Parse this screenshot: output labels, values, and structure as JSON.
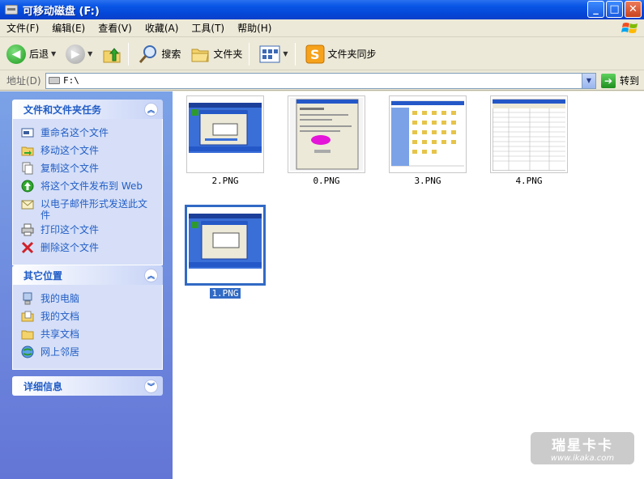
{
  "window": {
    "title": "可移动磁盘 (F:)",
    "btn_min": "_",
    "btn_max": "□",
    "btn_close": "✕"
  },
  "menu": [
    "文件(F)",
    "编辑(E)",
    "查看(V)",
    "收藏(A)",
    "工具(T)",
    "帮助(H)"
  ],
  "toolbar": {
    "back": "后退",
    "search": "搜索",
    "folders": "文件夹",
    "sync": "文件夹同步"
  },
  "address": {
    "label": "地址(D)",
    "value": "F:\\",
    "go": "转到"
  },
  "panels": {
    "tasks": {
      "title": "文件和文件夹任务",
      "items": [
        "重命名这个文件",
        "移动这个文件",
        "复制这个文件",
        "将这个文件发布到 Web",
        "以电子邮件形式发送此文件",
        "打印这个文件",
        "删除这个文件"
      ]
    },
    "places": {
      "title": "其它位置",
      "items": [
        "我的电脑",
        "我的文档",
        "共享文档",
        "网上邻居"
      ]
    },
    "details": {
      "title": "详细信息"
    }
  },
  "files": [
    {
      "name": "2.PNG"
    },
    {
      "name": "0.PNG"
    },
    {
      "name": "3.PNG"
    },
    {
      "name": "4.PNG"
    },
    {
      "name": "1.PNG",
      "selected": true
    }
  ],
  "watermark": {
    "brand": "瑞星卡卡",
    "url": "www.ikaka.com"
  }
}
